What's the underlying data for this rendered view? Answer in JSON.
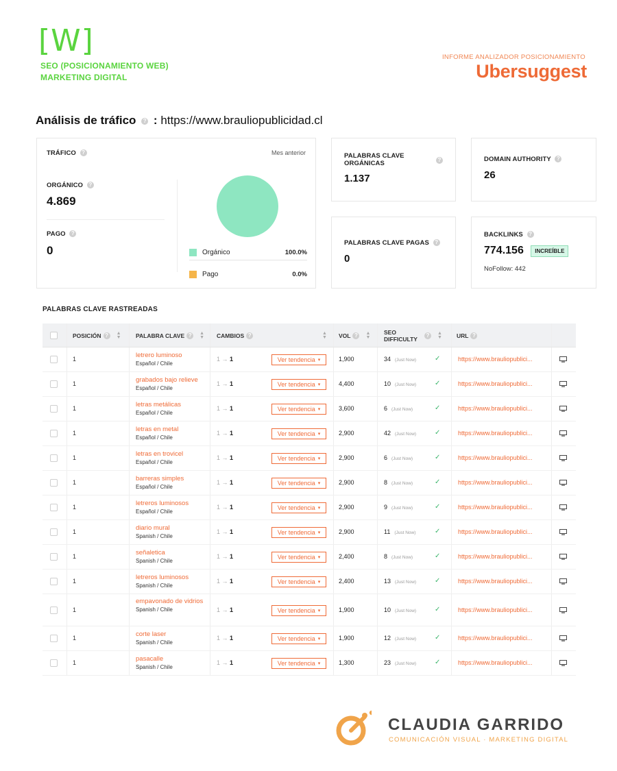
{
  "header": {
    "brand_mark": "[W]",
    "brand_line1": "SEO (POSICIONAMIENTO WEB)",
    "brand_line2": "MARKETING DIGITAL",
    "report_sub": "INFORME ANALIZADOR POSICIONAMIENTO",
    "report_title": "Ubersuggest"
  },
  "analysis": {
    "title": "Análisis de tráfico",
    "sep": ":",
    "domain": "https://www.brauliopublicidad.cl"
  },
  "traffic": {
    "label": "TRÁFICO",
    "period": "Mes anterior",
    "organic_label": "ORGÁNICO",
    "organic_value": "4.869",
    "paid_label": "PAGO",
    "paid_value": "0",
    "legend": [
      {
        "label": "Orgánico",
        "value": "100.0%",
        "color": "#8ee6c1"
      },
      {
        "label": "Pago",
        "value": "0.0%",
        "color": "#f5b54a"
      }
    ]
  },
  "stats": {
    "organic_kw_label": "PALABRAS CLAVE ORGÁNICAS",
    "organic_kw_value": "1.137",
    "da_label": "DOMAIN AUTHORITY",
    "da_value": "26",
    "paid_kw_label": "PALABRAS CLAVE PAGAS",
    "paid_kw_value": "0",
    "backlinks_label": "BACKLINKS",
    "backlinks_value": "774.156",
    "backlinks_badge": "INCREÍBLE",
    "nofollow": "NoFollow: 442"
  },
  "table": {
    "title": "PALABRAS CLAVE RASTREADAS",
    "columns": {
      "position": "POSICIÓN",
      "keyword": "PALABRA CLAVE",
      "changes": "CAMBIOS",
      "vol": "VOL",
      "seo_difficulty": "SEO DIFFICULTY",
      "url": "URL"
    },
    "trend_label": "Ver tendencia",
    "just_now": "(Just Now)",
    "rows": [
      {
        "pos": "1",
        "kw": "letrero luminoso",
        "lang": "Español / Chile",
        "from": "1",
        "to": "1",
        "vol": "1,900",
        "sd": "34",
        "url": "https://www.brauliopublici..."
      },
      {
        "pos": "1",
        "kw": "grabados bajo relieve",
        "lang": "Español / Chile",
        "from": "1",
        "to": "1",
        "vol": "4,400",
        "sd": "10",
        "url": "https://www.brauliopublici..."
      },
      {
        "pos": "1",
        "kw": "letras metálicas",
        "lang": "Español / Chile",
        "from": "1",
        "to": "1",
        "vol": "3,600",
        "sd": "6",
        "url": "https://www.brauliopublici..."
      },
      {
        "pos": "1",
        "kw": "letras en metal",
        "lang": "Español / Chile",
        "from": "1",
        "to": "1",
        "vol": "2,900",
        "sd": "42",
        "url": "https://www.brauliopublici..."
      },
      {
        "pos": "1",
        "kw": "letras en trovicel",
        "lang": "Español / Chile",
        "from": "1",
        "to": "1",
        "vol": "2,900",
        "sd": "6",
        "url": "https://www.brauliopublici..."
      },
      {
        "pos": "1",
        "kw": "barreras simples",
        "lang": "Español / Chile",
        "from": "1",
        "to": "1",
        "vol": "2,900",
        "sd": "8",
        "url": "https://www.brauliopublici..."
      },
      {
        "pos": "1",
        "kw": "letreros luminosos",
        "lang": "Español / Chile",
        "from": "1",
        "to": "1",
        "vol": "2,900",
        "sd": "9",
        "url": "https://www.brauliopublici..."
      },
      {
        "pos": "1",
        "kw": "diario mural",
        "lang": "Spanish / Chile",
        "from": "1",
        "to": "1",
        "vol": "2,900",
        "sd": "11",
        "url": "https://www.brauliopublici..."
      },
      {
        "pos": "1",
        "kw": "señaletica",
        "lang": "Spanish / Chile",
        "from": "1",
        "to": "1",
        "vol": "2,400",
        "sd": "8",
        "url": "https://www.brauliopublici..."
      },
      {
        "pos": "1",
        "kw": "letreros luminosos",
        "lang": "Spanish / Chile",
        "from": "1",
        "to": "1",
        "vol": "2,400",
        "sd": "13",
        "url": "https://www.brauliopublici..."
      },
      {
        "pos": "1",
        "kw": "empavonado de vidrios",
        "lang": "Spanish / Chile",
        "from": "1",
        "to": "1",
        "vol": "1,900",
        "sd": "10",
        "url": "https://www.brauliopublici..."
      },
      {
        "pos": "1",
        "kw": "corte laser",
        "lang": "Spanish / Chile",
        "from": "1",
        "to": "1",
        "vol": "1,900",
        "sd": "12",
        "url": "https://www.brauliopublici..."
      },
      {
        "pos": "1",
        "kw": "pasacalle",
        "lang": "Spanish / Chile",
        "from": "1",
        "to": "1",
        "vol": "1,300",
        "sd": "23",
        "url": "https://www.brauliopublici..."
      }
    ]
  },
  "footer": {
    "logo_name": "CLAUDIA GARRIDO",
    "logo_tag": "COMUNICACIÓN VISUAL · MARKETING DIGITAL"
  },
  "colors": {
    "accent": "#ef6a36",
    "brand_green": "#5ad43f",
    "pie_organic": "#8ee6c1",
    "pie_paid": "#f5b54a"
  }
}
